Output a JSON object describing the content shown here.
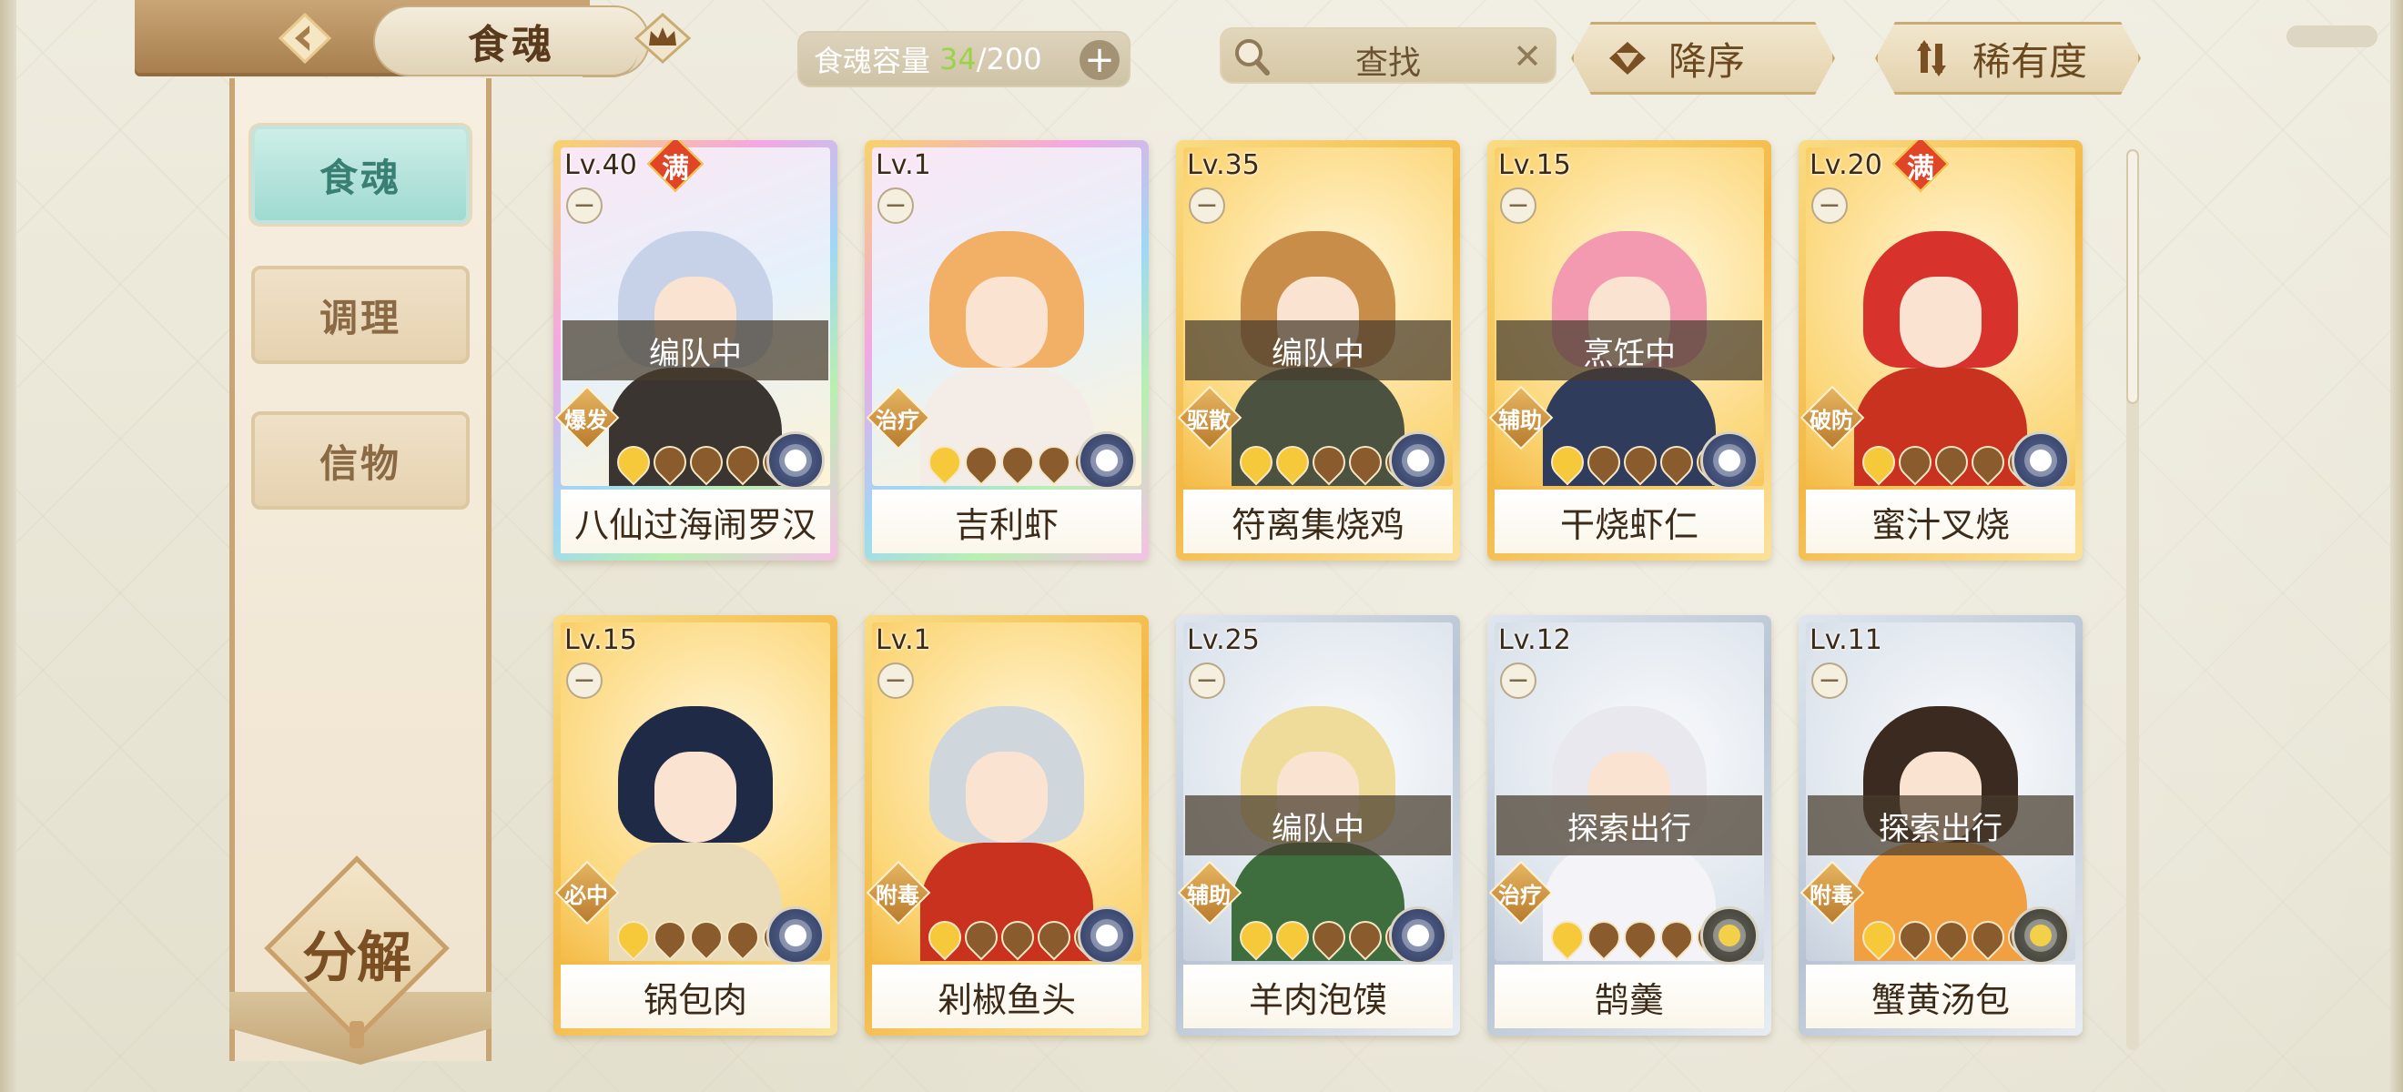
{
  "header": {
    "title": "食魂",
    "capacity_label": "食魂容量",
    "capacity_current": "34",
    "capacity_max": "/200",
    "search_placeholder": "查找",
    "sort_order": "降序",
    "sort_by": "稀有度"
  },
  "sidebar": {
    "tabs": [
      {
        "label": "食魂",
        "active": true
      },
      {
        "label": "调理",
        "active": false
      },
      {
        "label": "信物",
        "active": false
      }
    ],
    "decompose": "分解"
  },
  "colors": {
    "capacity_accent": "#9bd24a",
    "rainbow_frame": "#e9b8f0",
    "gold_frame": "#f5c54c",
    "silver_frame": "#b9c6d6",
    "tab_active": "#9fdad1"
  },
  "cards": [
    {
      "level": "Lv.40",
      "name": "八仙过海闹罗汉",
      "full_badge": "满",
      "status": "编队中",
      "role": "爆发",
      "stars": 1,
      "rarity": "rainbow",
      "element": "moon",
      "hair": "#c7d2e8",
      "outfit": "#3a3530"
    },
    {
      "level": "Lv.1",
      "name": "吉利虾",
      "full_badge": "",
      "status": "",
      "role": "治疗",
      "stars": 1,
      "rarity": "rainbow",
      "element": "moon",
      "hair": "#f2b066",
      "outfit": "#f4ece6"
    },
    {
      "level": "Lv.35",
      "name": "符离集烧鸡",
      "full_badge": "",
      "status": "编队中",
      "role": "驱散",
      "stars": 2,
      "rarity": "gold",
      "element": "moon",
      "hair": "#c98d4a",
      "outfit": "#4b5240"
    },
    {
      "level": "Lv.15",
      "name": "干烧虾仁",
      "full_badge": "",
      "status": "烹饪中",
      "role": "辅助",
      "stars": 1,
      "rarity": "gold",
      "element": "moon",
      "hair": "#f39ab0",
      "outfit": "#2f3c5c"
    },
    {
      "level": "Lv.20",
      "name": "蜜汁叉烧",
      "full_badge": "满",
      "status": "",
      "role": "破防",
      "stars": 1,
      "rarity": "gold",
      "element": "moon",
      "hair": "#d8322c",
      "outfit": "#c8321e"
    },
    {
      "level": "Lv.15",
      "name": "锅包肉",
      "full_badge": "",
      "status": "",
      "role": "必中",
      "stars": 1,
      "rarity": "gold",
      "element": "moon",
      "hair": "#1e2a46",
      "outfit": "#eadcb8"
    },
    {
      "level": "Lv.1",
      "name": "剁椒鱼头",
      "full_badge": "",
      "status": "",
      "role": "附毒",
      "stars": 1,
      "rarity": "gold",
      "element": "moon",
      "hair": "#cfd6dc",
      "outfit": "#c8321e"
    },
    {
      "level": "Lv.25",
      "name": "羊肉泡馍",
      "full_badge": "",
      "status": "编队中",
      "role": "辅助",
      "stars": 2,
      "rarity": "silver",
      "element": "moon",
      "hair": "#f0dc9a",
      "outfit": "#3e6e3e"
    },
    {
      "level": "Lv.12",
      "name": "鹄羹",
      "full_badge": "",
      "status": "探索出行",
      "role": "治疗",
      "stars": 1,
      "rarity": "silver",
      "element": "sun",
      "hair": "#e8e8ee",
      "outfit": "#f4f4f8"
    },
    {
      "level": "Lv.11",
      "name": "蟹黄汤包",
      "full_badge": "",
      "status": "探索出行",
      "role": "附毒",
      "stars": 1,
      "rarity": "silver",
      "element": "sun",
      "hair": "#3a2a20",
      "outfit": "#f0a040"
    }
  ],
  "icons": {
    "back": "back-arrow-icon",
    "crown": "crown-icon",
    "search": "magnifier-icon",
    "clear": "close-icon",
    "sort_desc": "triangle-down-icon",
    "sort_rarity": "swap-arrows-icon",
    "plus": "plus-icon"
  }
}
